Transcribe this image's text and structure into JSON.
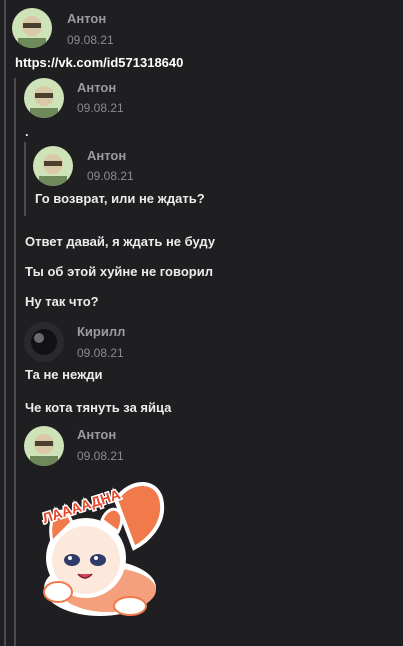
{
  "thread": {
    "m1": {
      "author": "Антон",
      "date": "09.08.21",
      "text": "https://vk.com/id571318640"
    },
    "m2": {
      "author": "Антон",
      "date": "09.08.21",
      "text": "."
    },
    "m3": {
      "author": "Антон",
      "date": "09.08.21",
      "text": "Го возврат, или не ждать?"
    },
    "lines": [
      "Ответ давай, я ждать не буду",
      "Ты об этой хуйне не говорил",
      "Ну так что?"
    ],
    "m4": {
      "author": "Кирилл",
      "date": "09.08.21",
      "lines": [
        "Та не нежди",
        "Че кота тянуть за яйца"
      ]
    },
    "m5": {
      "author": "Антон",
      "date": "09.08.21",
      "sticker_text": "ЛААААДНА"
    }
  },
  "colors": {
    "background": "#1f1f22",
    "quote_line": "#4a4a4f",
    "sticker_orange": "#f07a4a"
  }
}
